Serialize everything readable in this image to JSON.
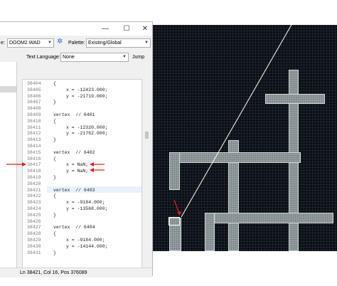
{
  "window": {
    "minimize_glyph": "—",
    "maximize_glyph": "☐",
    "close_glyph": "✕"
  },
  "toolbar": {
    "file_label": "e:",
    "file_value": "DOOM2.WAD",
    "palette_label": "Palette:",
    "palette_value": "Existing/Global"
  },
  "text_bar": {
    "language_label": "Text Language:",
    "language_value": "None",
    "jump_label": "Jump"
  },
  "editor": {
    "lines": [
      {
        "n": "38404",
        "t": "{"
      },
      {
        "n": "38405",
        "t": "x = -12423.000;"
      },
      {
        "n": "38406",
        "t": "y = -21719.000;"
      },
      {
        "n": "38407",
        "t": "}"
      },
      {
        "n": "38408",
        "t": ""
      },
      {
        "n": "38409",
        "t": "vertex  // 6401"
      },
      {
        "n": "38410",
        "t": "{"
      },
      {
        "n": "38411",
        "t": "x = -12320.000;"
      },
      {
        "n": "38412",
        "t": "y = -21762.000;"
      },
      {
        "n": "38413",
        "t": "}"
      },
      {
        "n": "38414",
        "t": ""
      },
      {
        "n": "38415",
        "t": "vertex  // 6402"
      },
      {
        "n": "38416",
        "t": "{"
      },
      {
        "n": "38417",
        "t": "x = NaN;"
      },
      {
        "n": "38418",
        "t": "y = NaN;"
      },
      {
        "n": "38419",
        "t": "}"
      },
      {
        "n": "38420",
        "t": ""
      },
      {
        "n": "38421",
        "t": "vertex  // 6403"
      },
      {
        "n": "38422",
        "t": "{"
      },
      {
        "n": "38423",
        "t": "x = -9184.000;"
      },
      {
        "n": "38424",
        "t": "y = -13568.000;"
      },
      {
        "n": "38425",
        "t": "}"
      },
      {
        "n": "38426",
        "t": ""
      },
      {
        "n": "38427",
        "t": "vertex  // 6404"
      },
      {
        "n": "38428",
        "t": "{"
      },
      {
        "n": "38429",
        "t": "x = -9184.000;"
      },
      {
        "n": "38430",
        "t": "y = -14144.000;"
      },
      {
        "n": "38431",
        "t": "}"
      }
    ]
  },
  "status": {
    "text": "Ln 38421, Col 16, Pos 376089"
  },
  "colors": {
    "annotation_red": "#e0201c",
    "map_background": "#0a0d12"
  }
}
